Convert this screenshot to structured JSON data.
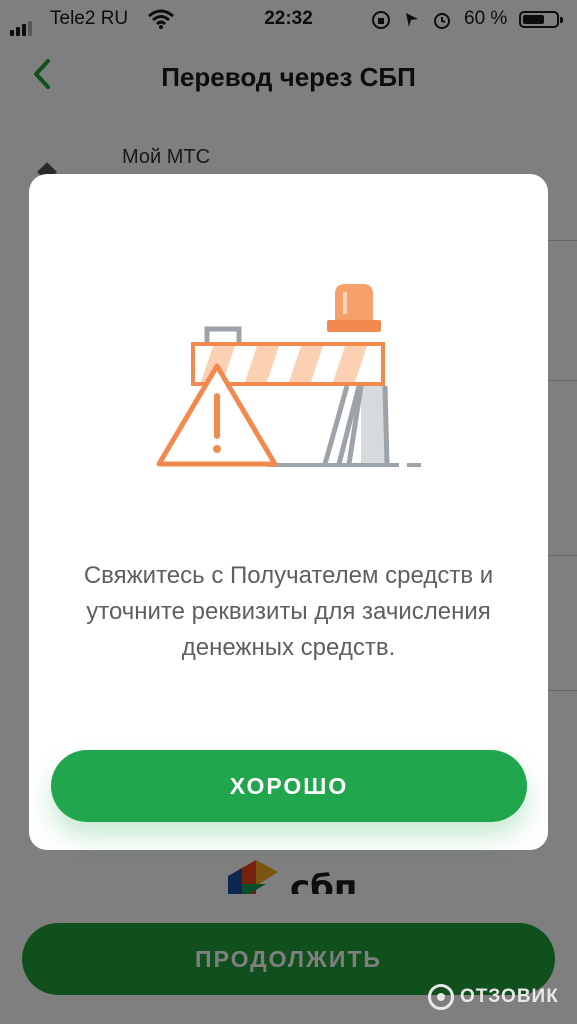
{
  "status_bar": {
    "carrier": "Tele2 RU",
    "time": "22:32",
    "battery": "60 %",
    "battery_level": 0.6
  },
  "nav": {
    "title": "Перевод через СБП"
  },
  "account": {
    "label": "Мой МТС"
  },
  "sbp_logo": {
    "text": "сбп"
  },
  "continue_button": {
    "label": "ПРОДОЛЖИТЬ"
  },
  "modal": {
    "message": "Свяжитесь с Получателем средств и уточните реквизиты для зачисления денежных средств.",
    "ok_label": "ХОРОШО"
  },
  "watermark": {
    "text": "ОТЗОВИК"
  },
  "colors": {
    "accent_green": "#21a038",
    "illustration_orange": "#f28a50"
  }
}
